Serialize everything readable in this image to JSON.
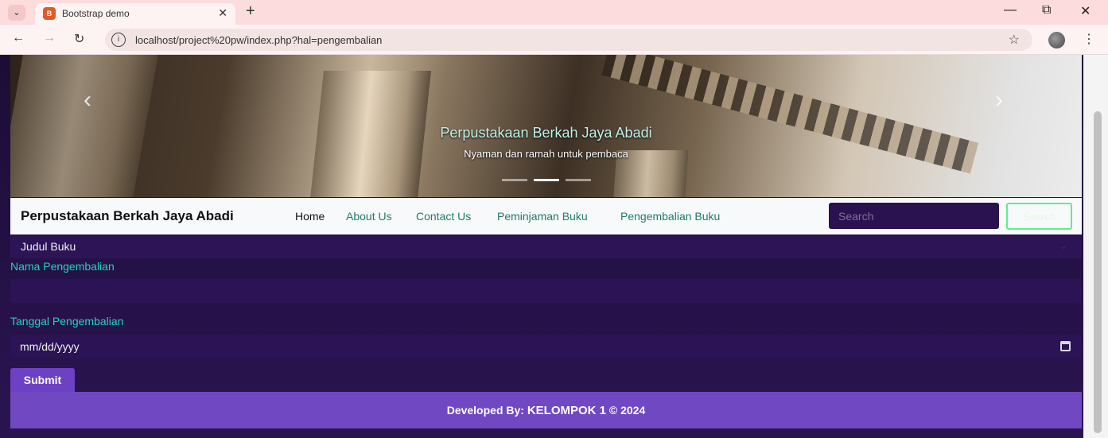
{
  "browser": {
    "tab_title": "Bootstrap demo",
    "favicon_glyph": "B",
    "url": "localhost/project%20pw/index.php?hal=pengembalian",
    "accent": "#fcdcdc"
  },
  "carousel": {
    "title": "Perpustakaan Berkah Jaya Abadi",
    "subtitle": "Nyaman dan ramah untuk pembaca",
    "prev_glyph": "‹",
    "next_glyph": "›"
  },
  "navbar": {
    "brand": "Perpustakaan Berkah Jaya Abadi",
    "links": [
      "Home",
      "About Us",
      "Contact Us",
      "Peminjaman Buku",
      "Pengembalian Buku"
    ],
    "search_placeholder": "Search",
    "search_button": "Search"
  },
  "form": {
    "judul_buku": "Judul Buku",
    "nama_label": "Nama Pengembalian",
    "tanggal_label": "Tanggal Pengembalian",
    "date_placeholder": "mm/dd/yyyy",
    "submit_label": "Submit"
  },
  "footer": {
    "prefix": "Developed By:",
    "team": "KELOMPOK 1",
    "suffix": "© 2024"
  },
  "colors": {
    "page_bg": "#1c0d36",
    "input_bg": "#2b1355",
    "label": "#22d3c0",
    "footer_bg": "#7048c2",
    "search_border": "#5cf08e"
  }
}
